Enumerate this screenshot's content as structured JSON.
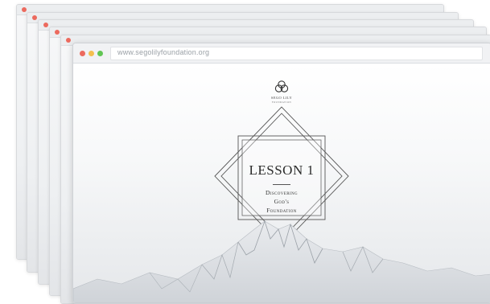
{
  "browser": {
    "url": "www.segolilyfoundation.org",
    "traffic_lights": {
      "close": "#ec6a5e",
      "minimize": "#f4bf4f",
      "zoom": "#61c554"
    }
  },
  "brand": {
    "name": "SEGO LILY",
    "subtitle": "FOUNDATION"
  },
  "slide": {
    "title": "LESSON 1",
    "subtitle_lines": [
      "Discovering",
      "God's",
      "Foundation"
    ]
  },
  "colors": {
    "accent_dark": "#2b2b2b",
    "mountain_light": "#dfe2e6",
    "mountain_dark": "#9aa0a7"
  }
}
